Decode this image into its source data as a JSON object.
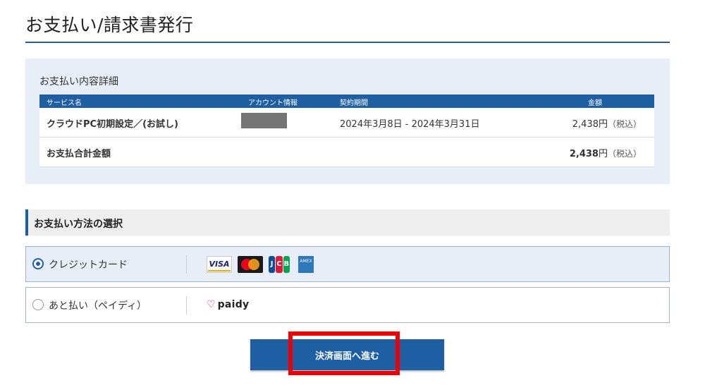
{
  "page": {
    "title": "お支払い/請求書発行"
  },
  "detail": {
    "heading": "お支払い内容詳細",
    "columns": [
      "サービス名",
      "アカウント情報",
      "契約期間",
      "金額"
    ],
    "row": {
      "service": "クラウドPC初期設定／(お試し)",
      "period": "2024年3月8日 - 2024年3月31日",
      "amount": "2,438円",
      "tax": "（税込）"
    },
    "total": {
      "label": "お支払合計金額",
      "amount": "2,438",
      "unit": "円",
      "tax": "（税込）"
    }
  },
  "payment": {
    "heading": "お支払い方法の選択",
    "options": [
      {
        "label": "クレジットカード",
        "selected": true,
        "brands": [
          "VISA",
          "mastercard",
          "JCB",
          "AMERICAN EXPRESS"
        ]
      },
      {
        "label": "あと払い（ペイディ）",
        "selected": false,
        "brand": "paidy"
      }
    ]
  },
  "actions": {
    "proceed": "決済画面へ進む"
  },
  "colors": {
    "accent": "#1e5ea3",
    "panel": "#e8eef7",
    "highlight": "#ee0000"
  }
}
